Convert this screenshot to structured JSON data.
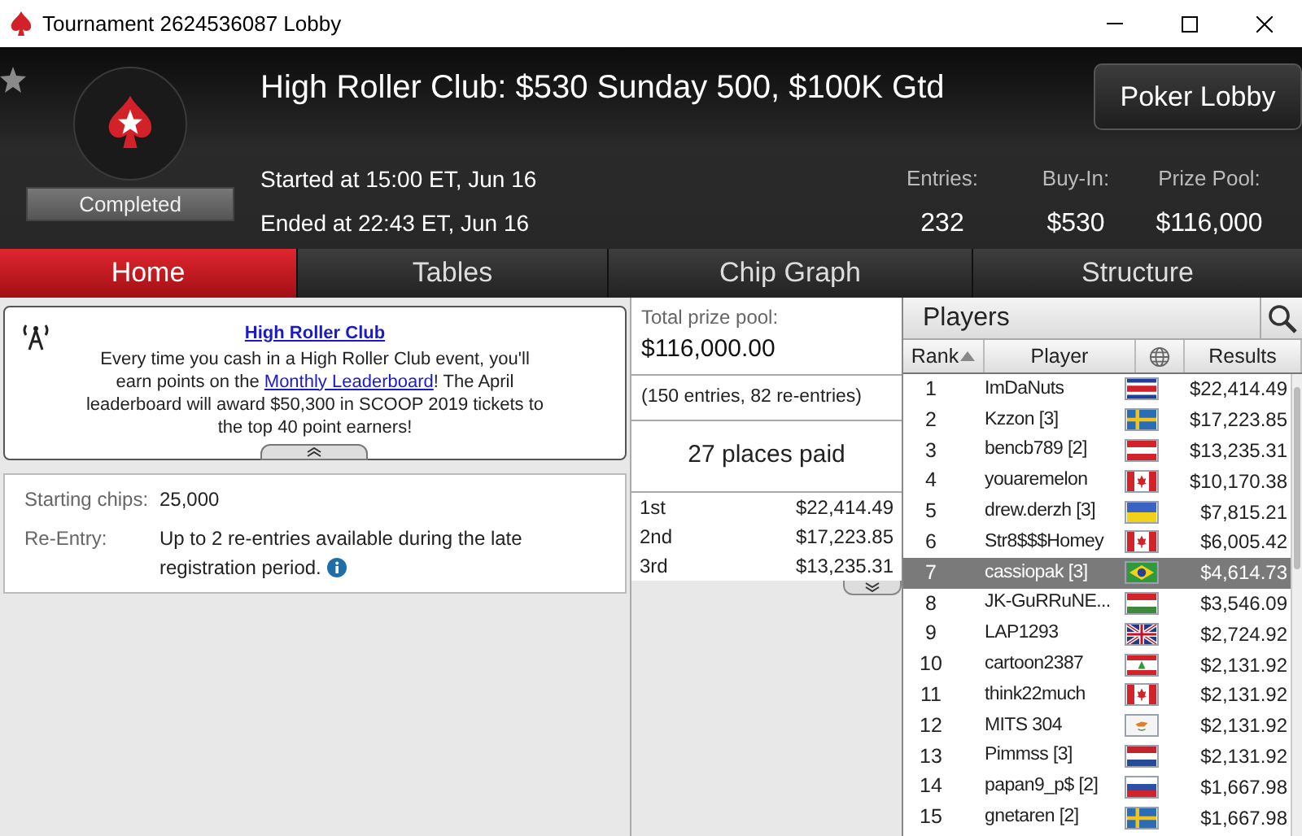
{
  "window": {
    "title": "Tournament 2624536087 Lobby"
  },
  "header": {
    "title": "High Roller Club: $530 Sunday 500, $100K Gtd",
    "status": "Completed",
    "started": "Started at 15:00 ET, Jun 16",
    "ended": "Ended at 22:43 ET, Jun 16",
    "lobby_button": "Poker Lobby",
    "stats": [
      {
        "label": "Entries:",
        "value": "232"
      },
      {
        "label": "Buy-In:",
        "value": "$530"
      },
      {
        "label": "Prize Pool:",
        "value": "$116,000"
      }
    ]
  },
  "tabs": [
    {
      "label": "Home",
      "selected": true
    },
    {
      "label": "Tables",
      "selected": false
    },
    {
      "label": "Chip Graph",
      "selected": false
    },
    {
      "label": "Structure",
      "selected": false
    }
  ],
  "announcement": {
    "title": "High Roller Club",
    "text_before": "Every time you cash in a High Roller Club event, you'll earn points on the ",
    "link": "Monthly Leaderboard",
    "text_after": "! The April leaderboard will award $50,300 in SCOOP 2019 tickets to the top 40 point earners!"
  },
  "details": [
    {
      "label": "Starting chips:",
      "value": "25,000",
      "info": false
    },
    {
      "label": "Re-Entry:",
      "value": "Up to 2 re-entries available during the late registration period.",
      "info": true
    }
  ],
  "prizes": {
    "label": "Total prize pool:",
    "total": "$116,000.00",
    "entries": "(150 entries, 82 re-entries)",
    "places": "27 places paid",
    "payouts": [
      {
        "place": "1st",
        "amount": "$22,414.49"
      },
      {
        "place": "2nd",
        "amount": "$17,223.85"
      },
      {
        "place": "3rd",
        "amount": "$13,235.31"
      }
    ]
  },
  "players": {
    "title": "Players",
    "columns": [
      {
        "kind": "text",
        "label": "Rank",
        "sorted": true
      },
      {
        "kind": "text",
        "label": "Player",
        "sorted": false
      },
      {
        "kind": "globe",
        "sorted": false
      },
      {
        "kind": "text",
        "label": "Results",
        "sorted": false
      }
    ],
    "rows": [
      {
        "rank": "1",
        "player": "ImDaNuts",
        "kind": "costa_rica",
        "result": "$22,414.49",
        "selected": false
      },
      {
        "rank": "2",
        "player": "Kzzon [3]",
        "kind": "sweden",
        "result": "$17,223.85",
        "selected": false
      },
      {
        "rank": "3",
        "player": "bencb789 [2]",
        "kind": "austria",
        "result": "$13,235.31",
        "selected": false
      },
      {
        "rank": "4",
        "player": "youaremelon",
        "kind": "canada",
        "result": "$10,170.38",
        "selected": false
      },
      {
        "rank": "5",
        "player": "drew.derzh [3]",
        "kind": "ukraine",
        "result": "$7,815.21",
        "selected": false
      },
      {
        "rank": "6",
        "player": "Str8$$$Homey",
        "kind": "canada",
        "result": "$6,005.42",
        "selected": false
      },
      {
        "rank": "7",
        "player": "cassiopak [3]",
        "kind": "brazil",
        "result": "$4,614.73",
        "selected": true
      },
      {
        "rank": "8",
        "player": "JK-GuRRuNE...",
        "kind": "hungary",
        "result": "$3,546.09",
        "selected": false
      },
      {
        "rank": "9",
        "player": "LAP1293",
        "kind": "uk",
        "result": "$2,724.92",
        "selected": false
      },
      {
        "rank": "10",
        "player": "cartoon2387",
        "kind": "lebanon",
        "result": "$2,131.92",
        "selected": false
      },
      {
        "rank": "11",
        "player": "think22much",
        "kind": "canada",
        "result": "$2,131.92",
        "selected": false
      },
      {
        "rank": "12",
        "player": "MITS 304",
        "kind": "cyprus",
        "result": "$2,131.92",
        "selected": false
      },
      {
        "rank": "13",
        "player": "Pimmss [3]",
        "kind": "netherlands",
        "result": "$2,131.92",
        "selected": false
      },
      {
        "rank": "14",
        "player": "papan9_p$ [2]",
        "kind": "russia",
        "result": "$1,667.98",
        "selected": false
      },
      {
        "rank": "15",
        "player": "gnetaren [2]",
        "kind": "sweden",
        "result": "$1,667.98",
        "selected": false
      }
    ]
  }
}
